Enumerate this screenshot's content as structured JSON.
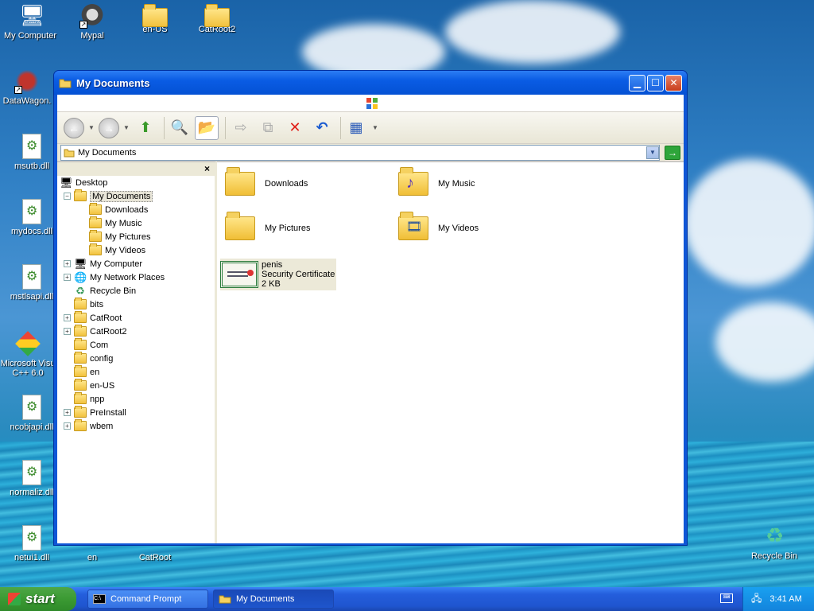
{
  "desktop": {
    "icons": [
      {
        "label": "My Computer"
      },
      {
        "label": "Mypal"
      },
      {
        "label": "en-US"
      },
      {
        "label": "CatRoot2"
      },
      {
        "label": "DataWagon."
      },
      {
        "label": "msutb.dll"
      },
      {
        "label": "mydocs.dll"
      },
      {
        "label": "mstlsapi.dll"
      },
      {
        "label": "Microsoft Visu C++ 6.0"
      },
      {
        "label": "ncobjapi.dll"
      },
      {
        "label": "normaliz.dll"
      },
      {
        "label": "netui1.dll"
      },
      {
        "label": "en"
      },
      {
        "label": "CatRoot"
      },
      {
        "label": "Recycle Bin"
      }
    ]
  },
  "window": {
    "title": "My Documents",
    "address": "My Documents",
    "tree": {
      "close": "×",
      "items": [
        {
          "label": "Desktop"
        },
        {
          "label": "My Documents"
        },
        {
          "label": "Downloads"
        },
        {
          "label": "My Music"
        },
        {
          "label": "My Pictures"
        },
        {
          "label": "My Videos"
        },
        {
          "label": "My Computer"
        },
        {
          "label": "My Network Places"
        },
        {
          "label": "Recycle Bin"
        },
        {
          "label": "bits"
        },
        {
          "label": "CatRoot"
        },
        {
          "label": "CatRoot2"
        },
        {
          "label": "Com"
        },
        {
          "label": "config"
        },
        {
          "label": "en"
        },
        {
          "label": "en-US"
        },
        {
          "label": "npp"
        },
        {
          "label": "PreInstall"
        },
        {
          "label": "wbem"
        }
      ]
    },
    "files": [
      {
        "name": "Downloads"
      },
      {
        "name": "My Music"
      },
      {
        "name": "My Pictures"
      },
      {
        "name": "My Videos"
      },
      {
        "name": "penis",
        "type": "Security Certificate",
        "size": "2 KB"
      }
    ]
  },
  "taskbar": {
    "start": "start",
    "tasks": [
      {
        "label": "Command Prompt"
      },
      {
        "label": "My Documents"
      }
    ],
    "clock": "3:41 AM"
  },
  "colors": {
    "title_bar": "#0a5ce4",
    "start_button": "#3b9a33",
    "taskbar": "#245edc"
  }
}
